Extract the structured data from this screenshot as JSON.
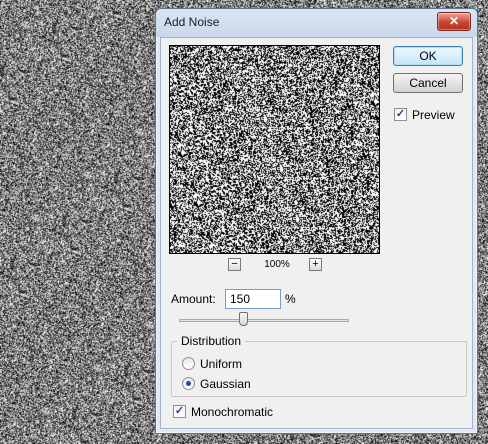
{
  "dialog": {
    "title": "Add Noise",
    "close_glyph": "✕"
  },
  "buttons": {
    "ok_label": "OK",
    "cancel_label": "Cancel"
  },
  "preview": {
    "checkbox_label": "Preview",
    "checked": true,
    "zoom_out_label": "−",
    "zoom_in_label": "+",
    "zoom_level": "100%"
  },
  "amount": {
    "label": "Amount:",
    "value": "150",
    "unit": "%",
    "slider_fraction": 0.4
  },
  "distribution": {
    "label": "Distribution",
    "options": [
      {
        "label": "Uniform",
        "selected": false
      },
      {
        "label": "Gaussian",
        "selected": true
      }
    ]
  },
  "monochromatic": {
    "label": "Monochromatic",
    "checked": true
  },
  "colors": {
    "title_bar": "#c8d8ec",
    "close_button": "#c7442f",
    "dialog_face": "#f0f0f0"
  },
  "icons": {
    "close": "close-icon",
    "check": "checkmark-icon"
  }
}
